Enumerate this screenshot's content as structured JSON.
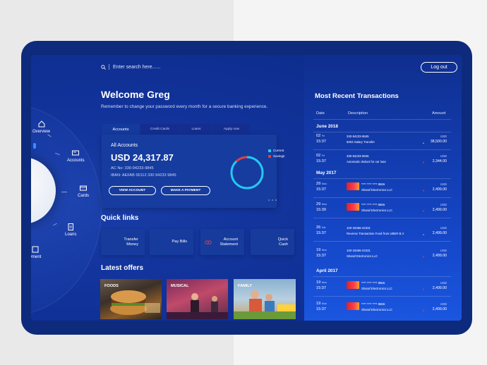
{
  "search": {
    "placeholder": "Enter search here......"
  },
  "header": {
    "logout_label": "Log out"
  },
  "welcome": {
    "title": "Welcome Greg",
    "reminder": "Remember to change your password every month for a secure banking experience."
  },
  "sidebar": {
    "items": [
      {
        "label": "Overview"
      },
      {
        "label": "Accounts"
      },
      {
        "label": "Cards"
      },
      {
        "label": "Loans"
      },
      {
        "label": "yment"
      }
    ]
  },
  "accounts": {
    "tabs": [
      "Accounts",
      "Credit Cards",
      "Loans",
      "Apply now"
    ],
    "label": "All Accounts",
    "balance": "USD 24,317.87",
    "account_no": "AC No: 330-94233-9845",
    "iban": "IBAN: AEFAB 00112 330 94233 9845",
    "view_button": "VIEW ACCOUNT",
    "pay_button": "MAKE A PAYMENT",
    "legend": [
      "Current",
      "Savings"
    ],
    "colors": {
      "current": "#22c9f2",
      "savings": "#e0403a"
    },
    "chart_data": {
      "type": "pie",
      "categories": [
        "Current",
        "Savings"
      ],
      "values": [
        88,
        12
      ]
    }
  },
  "quick_links": {
    "title": "Quick links",
    "items": [
      {
        "line1": "Transfer",
        "line2": "Money"
      },
      {
        "line1": "Pay Bills",
        "line2": ""
      },
      {
        "line1": "Account",
        "line2": "Statement"
      },
      {
        "line1": "Quick",
        "line2": "Cash"
      }
    ]
  },
  "offers": {
    "title": "Latest offers",
    "items": [
      "FOODS",
      "MUSICAL",
      "FAMILY"
    ]
  },
  "transactions": {
    "title": "Most Recent Transactions",
    "headers": {
      "date": "Date",
      "description": "Description",
      "amount": "Amount"
    },
    "groups": [
      {
        "month": "June 2018",
        "rows": [
          {
            "day": "02",
            "dow": "Fri",
            "time": "15:37",
            "account": "330-94233-9845",
            "desc": "5003 Salary Transfer",
            "cur": "USD",
            "amount": "38,500.00",
            "dir": "in"
          },
          {
            "day": "02",
            "dow": "Fri",
            "time": "15:37",
            "account": "330-94233-9845",
            "desc": "Automatic deduct for car loan",
            "cur": "USD",
            "amount": "2,344.00",
            "dir": "out"
          }
        ]
      },
      {
        "month": "May 2017",
        "rows": [
          {
            "day": "29",
            "dow": "Mon",
            "time": "15:37",
            "account": "**** **** **** 8865",
            "desc": "Sharaf Electronics LLC",
            "cur": "USD",
            "amount": "2,499.00",
            "dir": "out"
          },
          {
            "day": "29",
            "dow": "Mon",
            "time": "15:30",
            "account": "**** **** **** 8865",
            "desc": "Sharaf Electronics LLC",
            "cur": "USD",
            "amount": "2,499.00",
            "dir": "out"
          },
          {
            "day": "26",
            "dow": "Sat",
            "time": "15:37",
            "account": "100-33466-22331",
            "desc": "Reverse Transaction Fund from UBER B.V",
            "cur": "USD",
            "amount": "2,499.00",
            "dir": "in"
          },
          {
            "day": "19",
            "dow": "Mon",
            "time": "15:37",
            "account": "100-33466-22331",
            "desc": "Sharaf Electronics LLC",
            "cur": "USD",
            "amount": "2,499.00",
            "dir": "out"
          }
        ]
      },
      {
        "month": "April 2017",
        "rows": [
          {
            "day": "19",
            "dow": "Mon",
            "time": "15:37",
            "account": "**** **** **** 8865",
            "desc": "Sharaf Electronics LLC",
            "cur": "USD",
            "amount": "2,499.00",
            "dir": "out"
          },
          {
            "day": "19",
            "dow": "Mon",
            "time": "15:37",
            "account": "**** **** **** 8865",
            "desc": "Sharaf Electronics LLC",
            "cur": "USD",
            "amount": "2,499.00",
            "dir": "out"
          }
        ]
      }
    ]
  }
}
